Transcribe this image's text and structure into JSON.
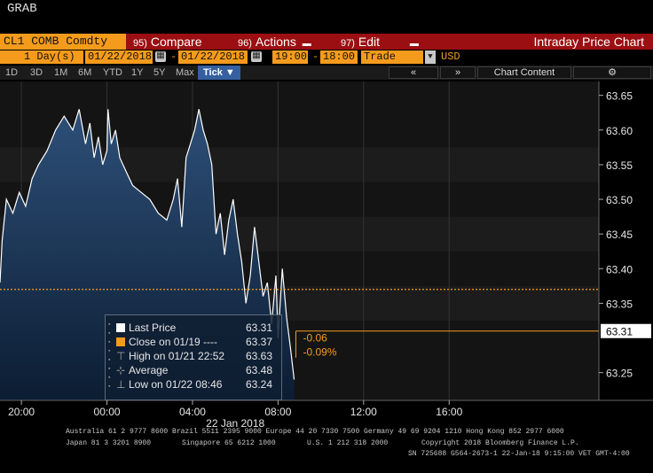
{
  "window": {
    "title": "GRAB"
  },
  "menubar": {
    "ticker": "CL1 COMB Comdty",
    "compare": {
      "num": "95)",
      "label": "Compare"
    },
    "actions": {
      "num": "96)",
      "label": "Actions"
    },
    "edit": {
      "num": "97)",
      "label": "Edit"
    },
    "title": "Intraday Price Chart"
  },
  "params": {
    "period_count": "1",
    "period_unit": "Day(s)",
    "start_date": "01/22/2018",
    "sep": "-",
    "end_date": "01/22/2018",
    "start_time": "19:00",
    "time_sep": "-",
    "end_time": "18:00",
    "event": "Trade",
    "currency": "USD"
  },
  "rangebar": {
    "buttons": [
      "1D",
      "3D",
      "1M",
      "6M",
      "YTD",
      "1Y",
      "5Y",
      "Max"
    ],
    "active": "Tick ▼",
    "collapse": "«",
    "expand": "»",
    "chart_content": "Chart Content",
    "settings": "⚙"
  },
  "legend": {
    "last": {
      "label": "Last Price",
      "value": "63.31"
    },
    "close": {
      "label": "Close on 01/19  ----",
      "value": "63.37"
    },
    "high": {
      "label": "High on 01/21 22:52",
      "value": "63.63"
    },
    "average": {
      "label": "Average",
      "value": "63.48"
    },
    "low": {
      "label": "Low on 01/22 08:46",
      "value": "63.24"
    }
  },
  "change": {
    "abs": "-0.06",
    "pct": "-0.09%"
  },
  "colors": {
    "orange": "#f59b1c",
    "red_bar": "#9b0f12",
    "area_top": "#1f3d63",
    "line": "#ffffff"
  },
  "chart_data": {
    "type": "area",
    "xlabel": "",
    "ylabel": "",
    "date_label": "22 Jan 2018",
    "x_ticks": [
      "20:00",
      "00:00",
      "04:00",
      "08:00",
      "12:00",
      "16:00"
    ],
    "y_ticks": [
      "63.65",
      "63.60",
      "63.55",
      "63.50",
      "63.45",
      "63.40",
      "63.35",
      "63.25"
    ],
    "ylim": [
      63.21,
      63.67
    ],
    "last_price_tag": "63.31",
    "reference_line": 63.37,
    "x_range_hours": [
      -5,
      23
    ],
    "series": [
      {
        "name": "Last Price",
        "x": [
          -5,
          -4.9,
          -4.7,
          -4.4,
          -4.1,
          -3.8,
          -3.5,
          -3.2,
          -2.8,
          -2.4,
          -2.0,
          -1.6,
          -1.3,
          -1.0,
          -0.8,
          -0.6,
          -0.4,
          -0.2,
          0.0,
          0.05,
          0.2,
          0.4,
          0.6,
          0.9,
          1.2,
          1.6,
          2.0,
          2.4,
          2.8,
          3.1,
          3.3,
          3.5,
          3.7,
          3.9,
          4.1,
          4.3,
          4.5,
          4.7,
          4.9,
          5.1,
          5.3,
          5.5,
          5.7,
          5.9,
          6.1,
          6.3,
          6.5,
          6.7,
          6.9,
          7.1,
          7.3,
          7.5,
          7.7,
          7.9,
          8.0,
          8.2,
          8.4,
          8.6,
          8.75
        ],
        "y": [
          63.38,
          63.44,
          63.5,
          63.48,
          63.51,
          63.49,
          63.53,
          63.55,
          63.57,
          63.6,
          63.62,
          63.6,
          63.63,
          63.58,
          63.61,
          63.56,
          63.59,
          63.55,
          63.57,
          63.63,
          63.58,
          63.6,
          63.56,
          63.54,
          63.52,
          63.51,
          63.5,
          63.48,
          63.47,
          63.5,
          63.53,
          63.46,
          63.56,
          63.58,
          63.6,
          63.63,
          63.6,
          63.58,
          63.55,
          63.45,
          63.48,
          63.42,
          63.47,
          63.5,
          63.45,
          63.41,
          63.35,
          63.39,
          63.46,
          63.41,
          63.36,
          63.38,
          63.32,
          63.39,
          63.3,
          63.4,
          63.33,
          63.28,
          63.24
        ]
      }
    ]
  },
  "footer": {
    "line1": "Australia 61 2 9777 8600 Brazil 5511 2395 9000 Europe 44 20 7330 7500 Germany 49 69 9204 1210 Hong Kong 852 2977 6000",
    "line2a": "Japan 81 3 3201 8900",
    "line2b": "Singapore 65 6212 1000",
    "line2c": "U.S. 1 212 318 2000",
    "line2d": "Copyright 2018 Bloomberg Finance L.P.",
    "line3": "SN 725688 G564-2673-1 22-Jan-18  9:15:00 VET  GMT-4:00"
  }
}
